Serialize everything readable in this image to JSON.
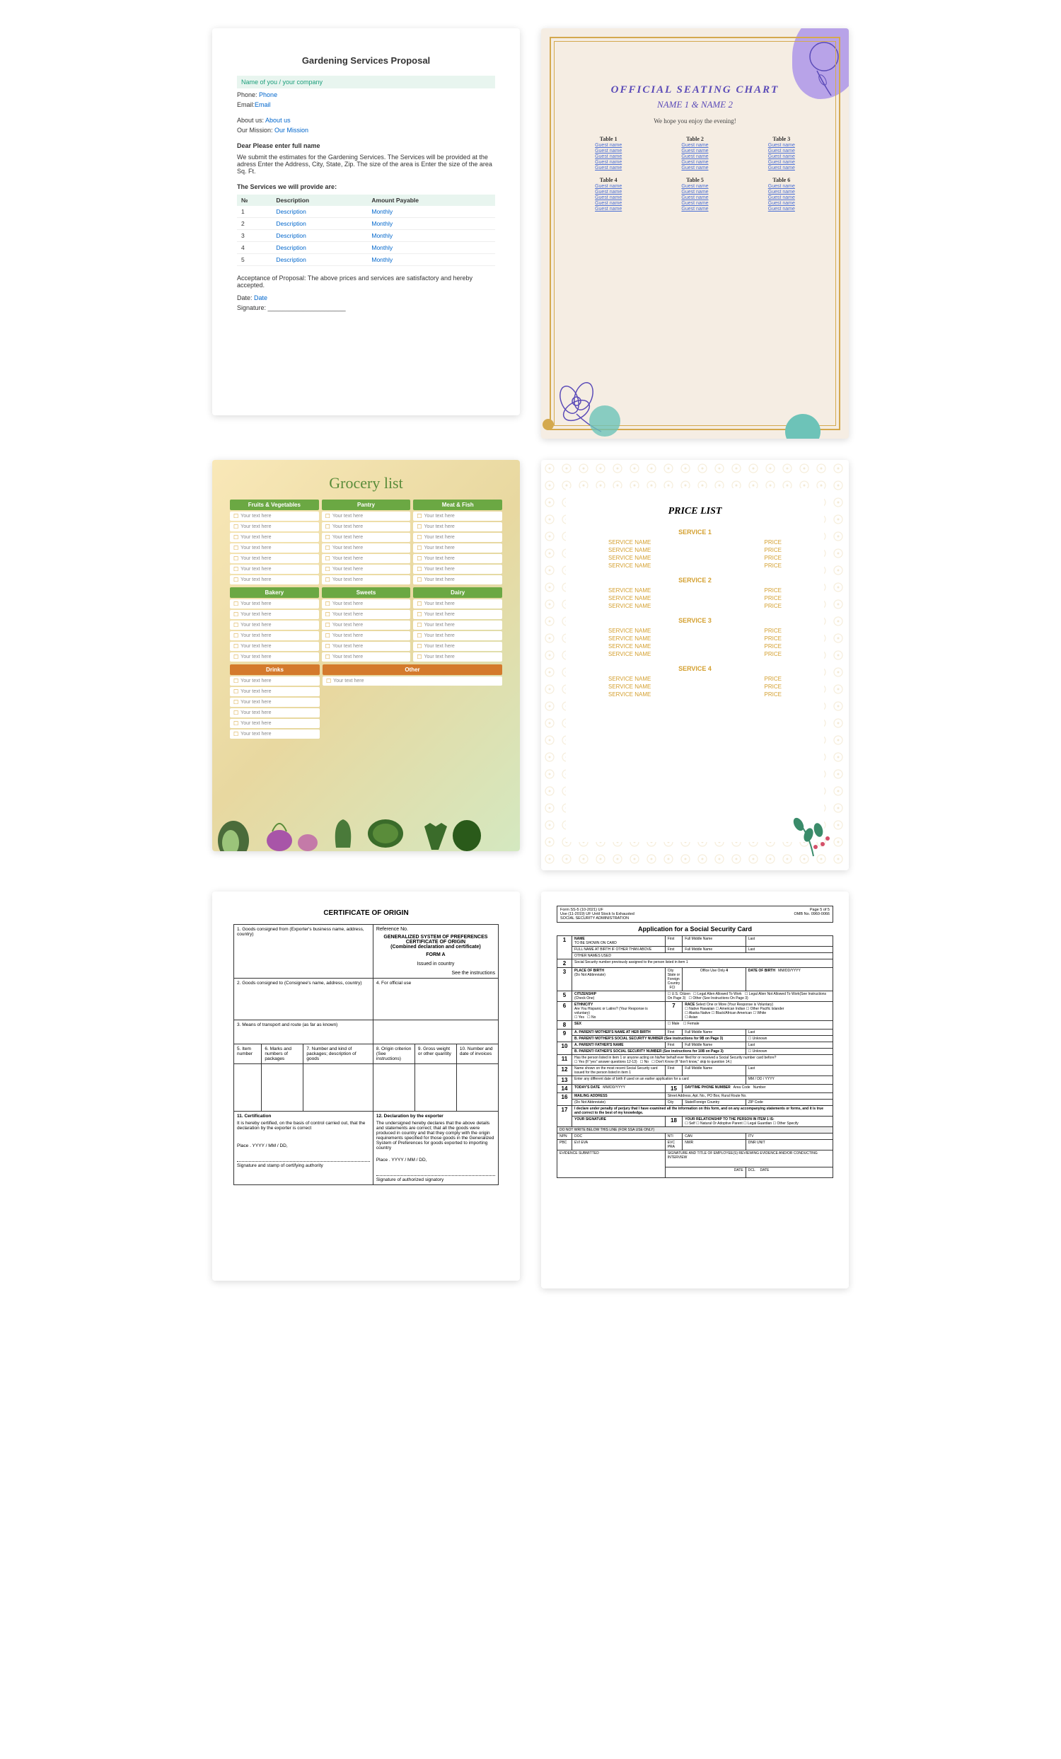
{
  "t1": {
    "title": "Gardening Services Proposal",
    "name_label": "Name of you / your company",
    "phone_label": "Phone:",
    "phone_link": "Phone",
    "email_label": "Email:",
    "email_link": "Email",
    "about_label": "About us:",
    "about_link": "About us",
    "mission_label": "Our Mission:",
    "mission_link": "Our Mission",
    "dear": "Dear  Please enter full name",
    "intro": "We submit the estimates for the Gardening Services. The Services will be provided at the adress Enter the Address, City, State, Zip. The size of the area is Enter the size of the area Sq. Ft.",
    "services_head": "The Services we will provide are:",
    "th1": "№",
    "th2": "Description",
    "th3": "Amount Payable",
    "rows": [
      {
        "n": "1",
        "d": "Description",
        "a": "Monthly"
      },
      {
        "n": "2",
        "d": "Description",
        "a": "Monthly"
      },
      {
        "n": "3",
        "d": "Description",
        "a": "Monthly"
      },
      {
        "n": "4",
        "d": "Description",
        "a": "Monthly"
      },
      {
        "n": "5",
        "d": "Description",
        "a": "Monthly"
      }
    ],
    "accept": "Acceptance of Proposal: The above prices and services are satisfactory and hereby accepted.",
    "date_label": "Date:",
    "date_link": "Date",
    "sig_label": "Signature: ______________________"
  },
  "t2": {
    "title": "OFFICIAL SEATING CHART",
    "name1": "NAME 1",
    "amp": "&",
    "name2": "NAME 2",
    "subtitle": "We hope you enjoy the evening!",
    "tables": [
      "Table 1",
      "Table 2",
      "Table 3",
      "Table 4",
      "Table 5",
      "Table 6"
    ],
    "guest": "Guest name"
  },
  "t3": {
    "title": "Grocery list",
    "heads1": [
      "Fruits & Vegetables",
      "Pantry",
      "Meat & Fish"
    ],
    "heads2": [
      "Bakery",
      "Sweets",
      "Dairy"
    ],
    "heads3": [
      "Drinks",
      "Other"
    ],
    "item": "Your text here"
  },
  "t4": {
    "title": "PRICE LIST",
    "sections": [
      "SERVICE 1",
      "SERVICE 2",
      "SERVICE 3",
      "SERVICE 4"
    ],
    "rows": [
      4,
      3,
      4,
      3
    ],
    "svc_name": "SERVICE NAME",
    "price": "PRICE"
  },
  "t5": {
    "title": "CERTIFICATE OF ORIGIN",
    "box1": "1. Goods consigned from (Exporter's business name, address, country)",
    "ref": "Reference No.",
    "gsp1": "GENERALIZED SYSTEM OF PREFERENCES",
    "gsp2": "CERTIFICATE OF ORIGIN",
    "gsp3": "(Combined declaration and certificate)",
    "gsp4": "FORM A",
    "gsp5": "Issued in country",
    "gsp6": "See the instructions",
    "box2": "2. Goods consigned to (Consignee's name, address, country)",
    "box3": "3. Means of transport and route (as far as known)",
    "box4": "4. For official use",
    "h5": "5. Item number",
    "h6": "6. Marks and numbers of packages",
    "h7": "7. Number and kind of packages; description of goods",
    "h8": "8. Origin criterion (See instructions)",
    "h9": "9. Gross weight or other quantity",
    "h10": "10. Number and date of invoices",
    "box11": "11. Certification",
    "box11t": "It is hereby certified, on the basis of control carried out, that the declaration by the exporter is correct",
    "box12": "12. Declaration by the exporter",
    "box12t": "The undersigned hereby declares that the above details and statements are correct; that all the goods were produced in country and that they comply with the origin requirements specified for those goods in the Generalized System of Preferences for goods exported to importing country",
    "place": "Place . YYYY / MM / DD,",
    "sig1": "Signature and stamp of certifying authority",
    "sig2": "Signature of authorized signatory"
  },
  "t6": {
    "form_no": "Form SS-5 (10-2021) UF",
    "use": "Use (11-2019) UF Until Stock Is Exhausted",
    "admin": "SOCIAL SECURITY ADMINISTRATION",
    "page": "Page 5 of 5",
    "omb": "OMB No. 0960-0066",
    "title": "Application for a Social Security Card",
    "r1": {
      "label": "NAME",
      "shown": "TO BE SHOWN ON CARD",
      "birth": "FULL NAME AT BIRTH IF OTHER THAN ABOVE",
      "other": "OTHER NAMES USED",
      "first": "First",
      "middle": "Full Middle Name",
      "last": "Last"
    },
    "r2": "Social Security number previously assigned to the person listed in item 1",
    "r3": {
      "label": "PLACE OF BIRTH",
      "note": "(Do Not Abbreviate)",
      "city": "City",
      "state": "State or Foreign Country",
      "fci": "FCI",
      "office": "Office Use Only"
    },
    "r4": {
      "label": "DATE OF BIRTH",
      "date": "MM/DD/YYYY"
    },
    "r5": {
      "label": "CITIZENSHIP",
      "check": "(Check One)",
      "opts": [
        "U.S. Citizen",
        "Legal Alien Allowed To Work",
        "Legal Alien Not Allowed To Work(See Instructions On Page 3)",
        "Other (See Instructions On Page 3)"
      ]
    },
    "r6": {
      "label": "ETHNICITY",
      "q": "Are You Hispanic or Latino? (Your Response is voluntary)",
      "opts": [
        "Yes",
        "No"
      ]
    },
    "r7": {
      "label": "RACE",
      "sel": "Select One or More (Your Response is Voluntary)",
      "opts": [
        "Native Hawaiian",
        "Alaska Native",
        "Asian",
        "American Indian",
        "Black/African American",
        "Other Pacific Islander",
        "White"
      ]
    },
    "r8": {
      "label": "SEX",
      "opts": [
        "Male",
        "Female"
      ]
    },
    "r9": {
      "label": "A. PARENT/ MOTHER'S NAME AT HER BIRTH",
      "ssn": "B. PARENT/ MOTHER'S SOCIAL SECURITY NUMBER (See instructions for 9B on Page 3)",
      "unknown": "Unknown"
    },
    "r10": {
      "label": "A. PARENT/ FATHER'S NAME",
      "ssn": "B. PARENT/ FATHER'S SOCIAL SECURITY NUMBER (See instructions for 10B on Page 3)"
    },
    "r11": {
      "q": "Has the person listed in item 1 or anyone acting on his/her behalf ever filed for or received a Social Security number card before?",
      "opts": [
        "Yes (If \"yes\" answer questions 12-13)",
        "No",
        "Don't Know (If \"don't know,\" skip to question 14.)"
      ]
    },
    "r12": "Name shown on the most recent Social Security card issued for the person listed in item 1",
    "r13": "Enter any different date of birth if used on an earlier application for a card",
    "r14": {
      "label": "TODAY'S DATE",
      "date": "MM/DD/YYYY"
    },
    "r15": {
      "label": "DAYTIME PHONE NUMBER",
      "area": "Area Code",
      "num": "Number"
    },
    "r16": {
      "label": "MAILING ADDRESS",
      "street": "Street Address, Apt. No., PO Box, Rural Route No.",
      "city": "City",
      "state": "State/Foreign Country",
      "zip": "ZIP Code",
      "note": "(Do Not Abbreviate)"
    },
    "r17": {
      "decl": "I declare under penalty of perjury that I have examined all the information on this form, and on any accompanying statements or forms, and it is true and correct to the best of my knowledge.",
      "label": "YOUR SIGNATURE"
    },
    "r18": {
      "label": "YOUR RELATIONSHIP TO THE PERSON IN ITEM 1 IS:",
      "opts": [
        "Self",
        "Natural Or Adoptive Parent",
        "Legal Guardian",
        "Other Specify"
      ]
    },
    "bottom": "DO NOT WRITE BELOW THIS LINE (FOR SSA USE ONLY)",
    "codes": [
      "NPN",
      "DOC",
      "NTI",
      "CAN",
      "ITV",
      "PBC",
      "EVI",
      "EVA",
      "EVC",
      "PRA",
      "NWR",
      "DNR",
      "UNIT"
    ],
    "evidence": "EVIDENCE SUBMITTED",
    "sigtitle": "SIGNATURE AND TITLE OF EMPLOYEE(S) REVIEWING EVIDENCE AND/OR CONDUCTING INTERVIEW",
    "dcl": "DCL",
    "date": "DATE"
  }
}
